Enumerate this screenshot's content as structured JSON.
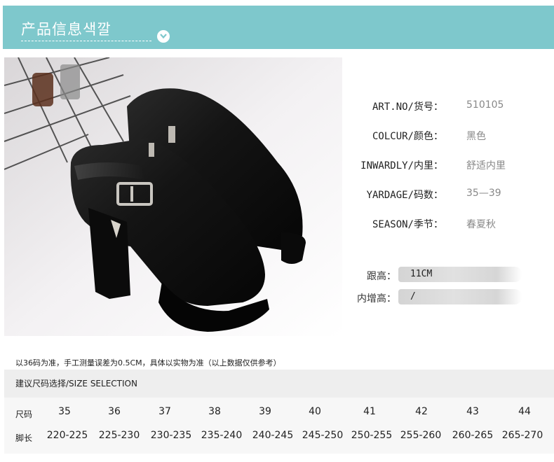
{
  "header": {
    "title": "产品信息색깔"
  },
  "specs": [
    {
      "label": "ART.NO/货号：",
      "value": "510105"
    },
    {
      "label": "COLCUR/颜色：",
      "value": "黑色"
    },
    {
      "label": "INWARDLY/内里：",
      "value": "舒适内里"
    },
    {
      "label": "YARDAGE/码数：",
      "value": "35—39"
    },
    {
      "label": "SEASON/季节：",
      "value": "春夏秋"
    }
  ],
  "heel": [
    {
      "label": "跟高：",
      "value": "11CM"
    },
    {
      "label": "内增高：",
      "value": "/"
    }
  ],
  "note": "以36码为准，手工测量误差为0.5CM，具体以实物为准（以上数据仅供参考）",
  "size_table": {
    "title": "建议尺码选择/SIZE SELECTION",
    "size_label": "尺码",
    "length_label": "脚长",
    "sizes": [
      "35",
      "36",
      "37",
      "38",
      "39",
      "40",
      "41",
      "42",
      "43",
      "44"
    ],
    "lengths": [
      "220-225",
      "225-230",
      "230-235",
      "235-240",
      "240-245",
      "245-250",
      "250-255",
      "255-260",
      "260-265",
      "265-270"
    ]
  },
  "colors": {
    "banner": "#7ec8cc",
    "table_header": "#eeeeee"
  },
  "icons": {
    "banner_toggle": "chevron-down-icon",
    "product_photo": "shoe-photo"
  }
}
